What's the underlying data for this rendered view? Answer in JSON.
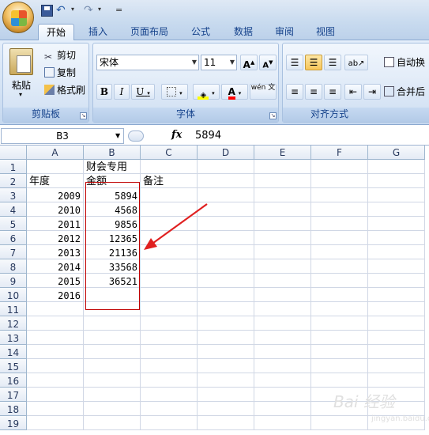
{
  "title_bar": {
    "undo_arrow": "▾",
    "redo_arrow": "▾",
    "customize": "="
  },
  "tabs": [
    "开始",
    "插入",
    "页面布局",
    "公式",
    "数据",
    "审阅",
    "视图"
  ],
  "clipboard": {
    "paste": "粘贴",
    "cut": "剪切",
    "copy": "复制",
    "format_painter": "格式刷",
    "label": "剪贴板"
  },
  "font": {
    "name": "宋体",
    "size": "11",
    "grow": "A",
    "shrink": "A",
    "bold": "B",
    "italic": "I",
    "underline": "U",
    "font_color_glyph": "A",
    "phonetic": "wén 文",
    "label": "字体"
  },
  "alignment": {
    "wrap_text": "自动换",
    "merge": "合并后",
    "label": "对齐方式"
  },
  "formula_bar": {
    "namebox": "B3",
    "fx": "fx",
    "value": "5894"
  },
  "columns": [
    "A",
    "B",
    "C",
    "D",
    "E",
    "F",
    "G"
  ],
  "rows": [
    "1",
    "2",
    "3",
    "4",
    "5",
    "6",
    "7",
    "8",
    "9",
    "10",
    "11",
    "12",
    "13",
    "14",
    "15",
    "16",
    "17",
    "18",
    "19"
  ],
  "cells": {
    "B1": "财会专用",
    "A2": "年度",
    "B2": "金额",
    "C2": "备注",
    "A3": "2009",
    "B3": "5894",
    "A4": "2010",
    "B4": "4568",
    "A5": "2011",
    "B5": "9856",
    "A6": "2012",
    "B6": "12365",
    "A7": "2013",
    "B7": "21136",
    "A8": "2014",
    "B8": "33568",
    "A9": "2015",
    "B9": "36521",
    "A10": "2016"
  },
  "colors": {
    "accent": "#c00000",
    "ribbon": "#d3e2f4",
    "tab_text": "#15428b"
  },
  "watermark": {
    "text": "Bai 经验",
    "sub": "jingyan.baidu.com"
  }
}
